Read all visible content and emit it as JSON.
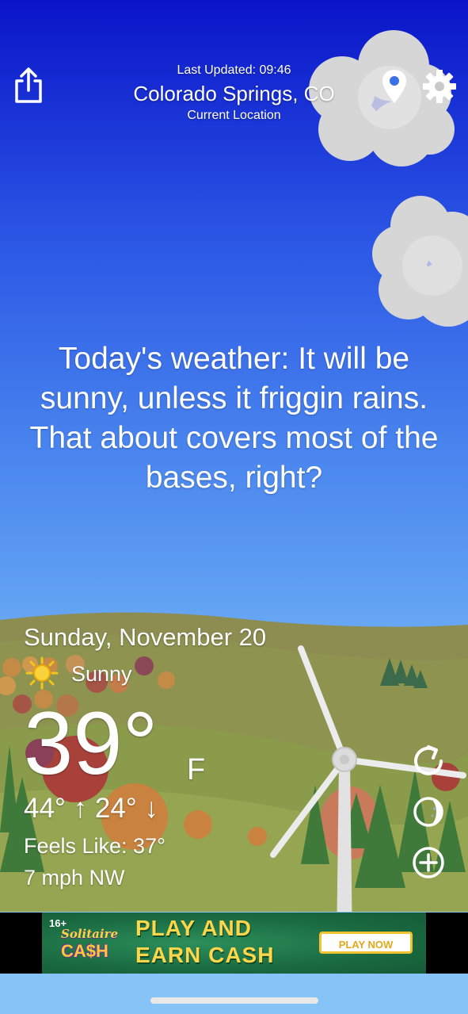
{
  "header": {
    "last_updated": "Last Updated: 09:46",
    "location_name": "Colorado Springs, CO",
    "location_sub": "Current Location",
    "share_icon": "share-icon",
    "pin_icon": "location-pin-icon",
    "settings_icon": "gear-icon"
  },
  "message": "Today's weather: It will be sunny, unless it friggin rains. That about covers most of the bases, right?",
  "weather": {
    "date": "Sunday, November 20",
    "condition": "Sunny",
    "condition_icon": "sun-icon",
    "temperature": "39°",
    "unit": "F",
    "hilo": "44° ↑  24° ↓",
    "feels_like": "Feels Like: 37°",
    "wind": "7 mph NW"
  },
  "actions": {
    "refresh_icon": "refresh-icon",
    "moon_icon": "moon-icon",
    "add_icon": "add-icon"
  },
  "ad": {
    "age_rating": "16+",
    "logo_top": "Solitaire",
    "logo_bottom": "CA$H",
    "headline_line1": "PLAY AND",
    "headline_line2": "EARN CASH",
    "cta": "PLAY NOW"
  },
  "colors": {
    "sky_top": "#0a14c8",
    "sky_bottom": "#86c3f7",
    "ad_background": "#1a6a41",
    "ad_text": "#ffd54a"
  }
}
